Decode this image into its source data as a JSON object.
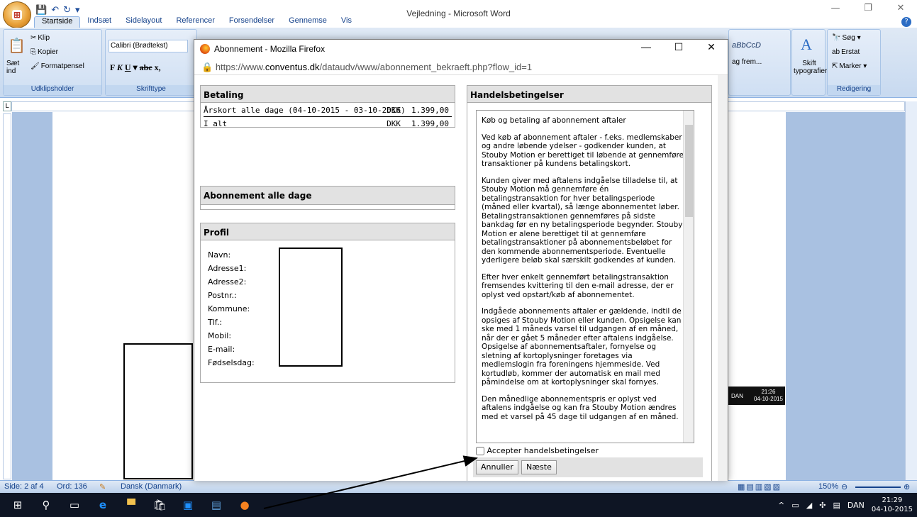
{
  "word": {
    "title": "Vejledning - Microsoft Word",
    "tabs": [
      "Startside",
      "Indsæt",
      "Sidelayout",
      "Referencer",
      "Forsendelser",
      "Gennemse",
      "Vis"
    ],
    "clipboard": {
      "paste": "Sæt ind",
      "cut": "Klip",
      "copy": "Kopier",
      "format_painter": "Formatpensel",
      "group": "Udklipsholder"
    },
    "font": {
      "name": "Calibri (Brødtekst)",
      "group": "Skrifttype"
    },
    "styles": {
      "preview": "aBbCcD",
      "next": "ag frem...",
      "change_styles": "Skift typografier"
    },
    "editing": {
      "find": "Søg",
      "replace": "Erstat",
      "select": "Marker",
      "group": "Redigering"
    },
    "status": {
      "page": "Side: 2 af 4",
      "words": "Ord: 136",
      "language": "Dansk (Danmark)",
      "zoom": "150%"
    },
    "notify": {
      "lang": "DAN",
      "time": "21:26",
      "date": "04-10-2015"
    }
  },
  "firefox": {
    "title": "Abonnement - Mozilla Firefox",
    "url_prefix": "https://www.",
    "url_host": "conventus.dk",
    "url_path": "/dataudv/www/abonnement_bekraeft.php?flow_id=1",
    "betaling": {
      "heading": "Betaling",
      "rows": [
        {
          "item": "Årskort alle dage (04-10-2015 - 03-10-2016)",
          "currency": "DKK",
          "amount": "1.399,00"
        },
        {
          "item": "I alt",
          "currency": "DKK",
          "amount": "1.399,00"
        }
      ]
    },
    "abonnement": {
      "heading": "Abonnement alle dage"
    },
    "profil": {
      "heading": "Profil",
      "labels": [
        "Navn:",
        "Adresse1:",
        "Adresse2:",
        "Postnr.:",
        "Kommune:",
        "Tlf.:",
        "Mobil:",
        "E-mail:",
        "Fødselsdag:"
      ]
    },
    "terms": {
      "heading": "Handelsbetingelser",
      "paragraphs": [
        "Køb og betaling af abonnement aftaler",
        "Ved køb af abonnement aftaler - f.eks. medlemskaber og andre løbende ydelser - godkender kunden, at Stouby Motion er berettiget til løbende at gennemføre transaktioner på kundens betalingskort.",
        "Kunden giver med aftalens indgåelse tilladelse til, at Stouby Motion må gennemføre én betalingstransaktion for hver betalingsperiode (måned eller kvartal), så længe abonnementet løber. Betalingstransaktionen gennemføres på sidste bankdag før en ny betalingsperiode begynder. Stouby Motion er alene berettiget til at gennemføre betalingstransaktioner på abonnementsbeløbet for den kommende abonnementsperiode. Eventuelle yderligere beløb skal særskilt godkendes af kunden.",
        "Efter hver enkelt gennemført betalingstransaktion fremsendes kvittering til den e-mail adresse, der er oplyst ved opstart/køb af abonnementet.",
        "Indgåede abonnements aftaler er gældende, indtil de opsiges af Stouby Motion eller kunden. Opsigelse kan ske med 1 måneds varsel til udgangen af en måned, når der er gået 5 måneder efter aftalens indgåelse. Opsigelse af abonnementsaftaler, fornyelse og sletning af kortoplysninger foretages via medlemslogin fra foreningens hjemmeside. Ved kortudløb, kommer der automatisk en mail med påmindelse om at kortoplysninger skal fornyes.",
        "Den månedlige abonnementspris er oplyst ved aftalens indgåelse og kan fra Stouby Motion ændres med et varsel på 45 dage til udgangen af en måned."
      ],
      "accept_label": "Accepter handelsbetingelser",
      "cancel_label": "Annuller",
      "next_label": "Næste"
    }
  },
  "taskbar": {
    "lang": "DAN",
    "time": "21:29",
    "date": "04-10-2015"
  }
}
